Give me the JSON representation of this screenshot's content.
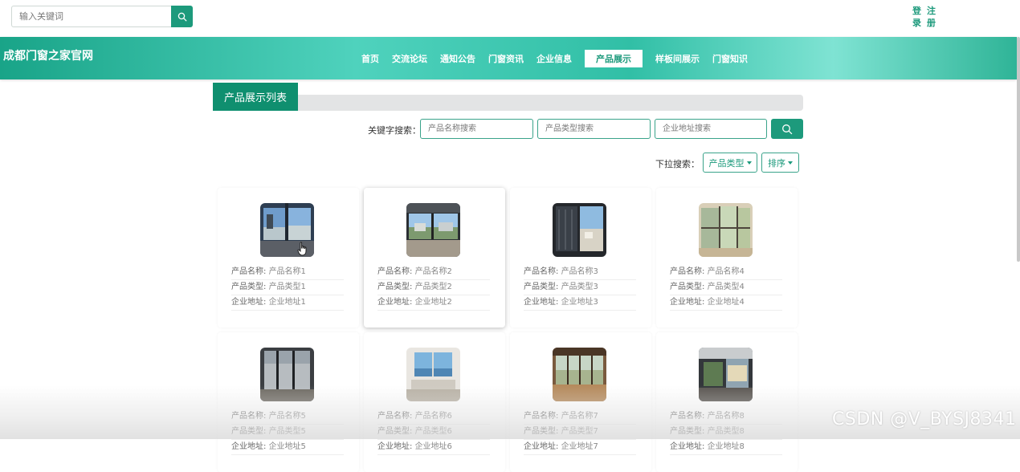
{
  "header": {
    "search_placeholder": "输入关键词",
    "login_label": "登录",
    "register_label": "注册",
    "login_top": "登",
    "login_bottom": "录",
    "register_top": "注",
    "register_bottom": "册"
  },
  "site": {
    "title": "成都门窗之家官网"
  },
  "nav": {
    "items": [
      "首页",
      "交流论坛",
      "通知公告",
      "门窗资讯",
      "企业信息",
      "产品展示",
      "样板间展示",
      "门窗知识"
    ],
    "active_index": 5
  },
  "section": {
    "title": "产品展示列表"
  },
  "filters": {
    "keyword_label": "关键字搜索：",
    "name_placeholder": "产品名称搜索",
    "type_placeholder": "产品类型搜索",
    "address_placeholder": "企业地址搜索",
    "dropdown_label": "下拉搜索：",
    "type_dropdown": "产品类型",
    "sort_dropdown": "排序"
  },
  "products": [
    {
      "name_label": "产品名称:",
      "name": "产品名称1",
      "type_label": "产品类型:",
      "type": "产品类型1",
      "addr_label": "企业地址:",
      "addr": "企业地址1"
    },
    {
      "name_label": "产品名称:",
      "name": "产品名称2",
      "type_label": "产品类型:",
      "type": "产品类型2",
      "addr_label": "企业地址:",
      "addr": "企业地址2"
    },
    {
      "name_label": "产品名称:",
      "name": "产品名称3",
      "type_label": "产品类型:",
      "type": "产品类型3",
      "addr_label": "企业地址:",
      "addr": "企业地址3"
    },
    {
      "name_label": "产品名称:",
      "name": "产品名称4",
      "type_label": "产品类型:",
      "type": "产品类型4",
      "addr_label": "企业地址:",
      "addr": "企业地址4"
    },
    {
      "name_label": "产品名称:",
      "name": "产品名称5",
      "type_label": "产品类型:",
      "type": "产品类型5",
      "addr_label": "企业地址:",
      "addr": "企业地址5"
    },
    {
      "name_label": "产品名称:",
      "name": "产品名称6",
      "type_label": "产品类型:",
      "type": "产品类型6",
      "addr_label": "企业地址:",
      "addr": "企业地址6"
    },
    {
      "name_label": "产品名称:",
      "name": "产品名称7",
      "type_label": "产品类型:",
      "type": "产品类型7",
      "addr_label": "企业地址:",
      "addr": "企业地址7"
    },
    {
      "name_label": "产品名称:",
      "name": "产品名称8",
      "type_label": "产品类型:",
      "type": "产品类型8",
      "addr_label": "企业地址:",
      "addr": "企业地址8"
    }
  ],
  "watermark": "CSDN @V_BYSJ8341",
  "colors": {
    "accent": "#1d9a7c",
    "section_title_bg": "#0f8f6f"
  },
  "icons": {
    "search": "search-icon",
    "caret": "caret-down-icon",
    "cursor": "hand-pointer-icon"
  }
}
